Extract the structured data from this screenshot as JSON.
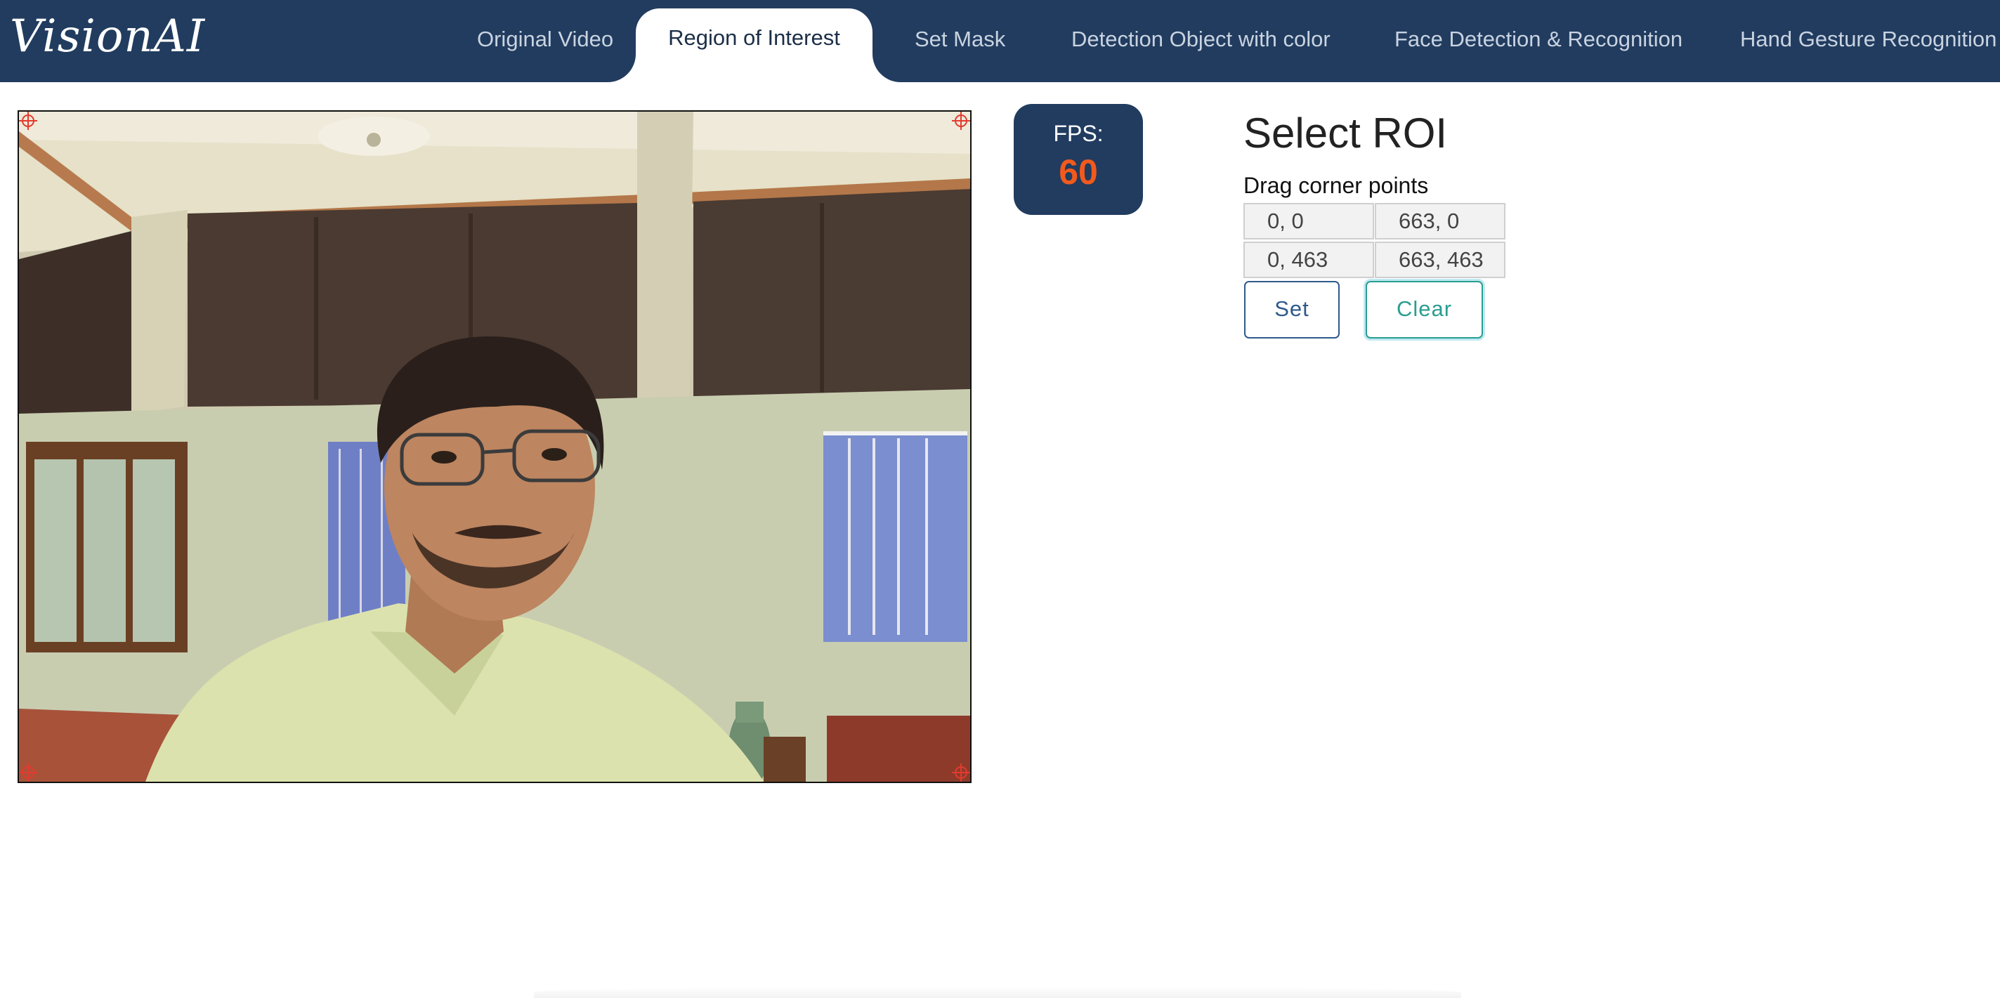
{
  "app": {
    "logo_text": "VisionAI"
  },
  "nav": {
    "tabs": [
      {
        "label": "Original Video"
      },
      {
        "label": "Region of Interest",
        "active": true
      },
      {
        "label": "Set Mask"
      },
      {
        "label": "Detection Object with color"
      },
      {
        "label": "Face Detection & Recognition"
      },
      {
        "label": "Hand Gesture Recognition"
      }
    ]
  },
  "fps": {
    "label": "FPS:",
    "value": "60"
  },
  "roi": {
    "title": "Select ROI",
    "instruction": "Drag corner points",
    "points": {
      "top_left": "0, 0",
      "top_right": "663, 0",
      "bottom_left": "0, 463",
      "bottom_right": "663, 463"
    },
    "set_label": "Set",
    "clear_label": "Clear"
  },
  "colors": {
    "nav_bg": "#213c5f",
    "fps_value": "#f25a1d",
    "set_button": "#2e5a8a",
    "clear_button": "#2a9d8f",
    "handle": "#e23b2e"
  },
  "icons": {
    "corner_handle": "crosshair-icon"
  }
}
